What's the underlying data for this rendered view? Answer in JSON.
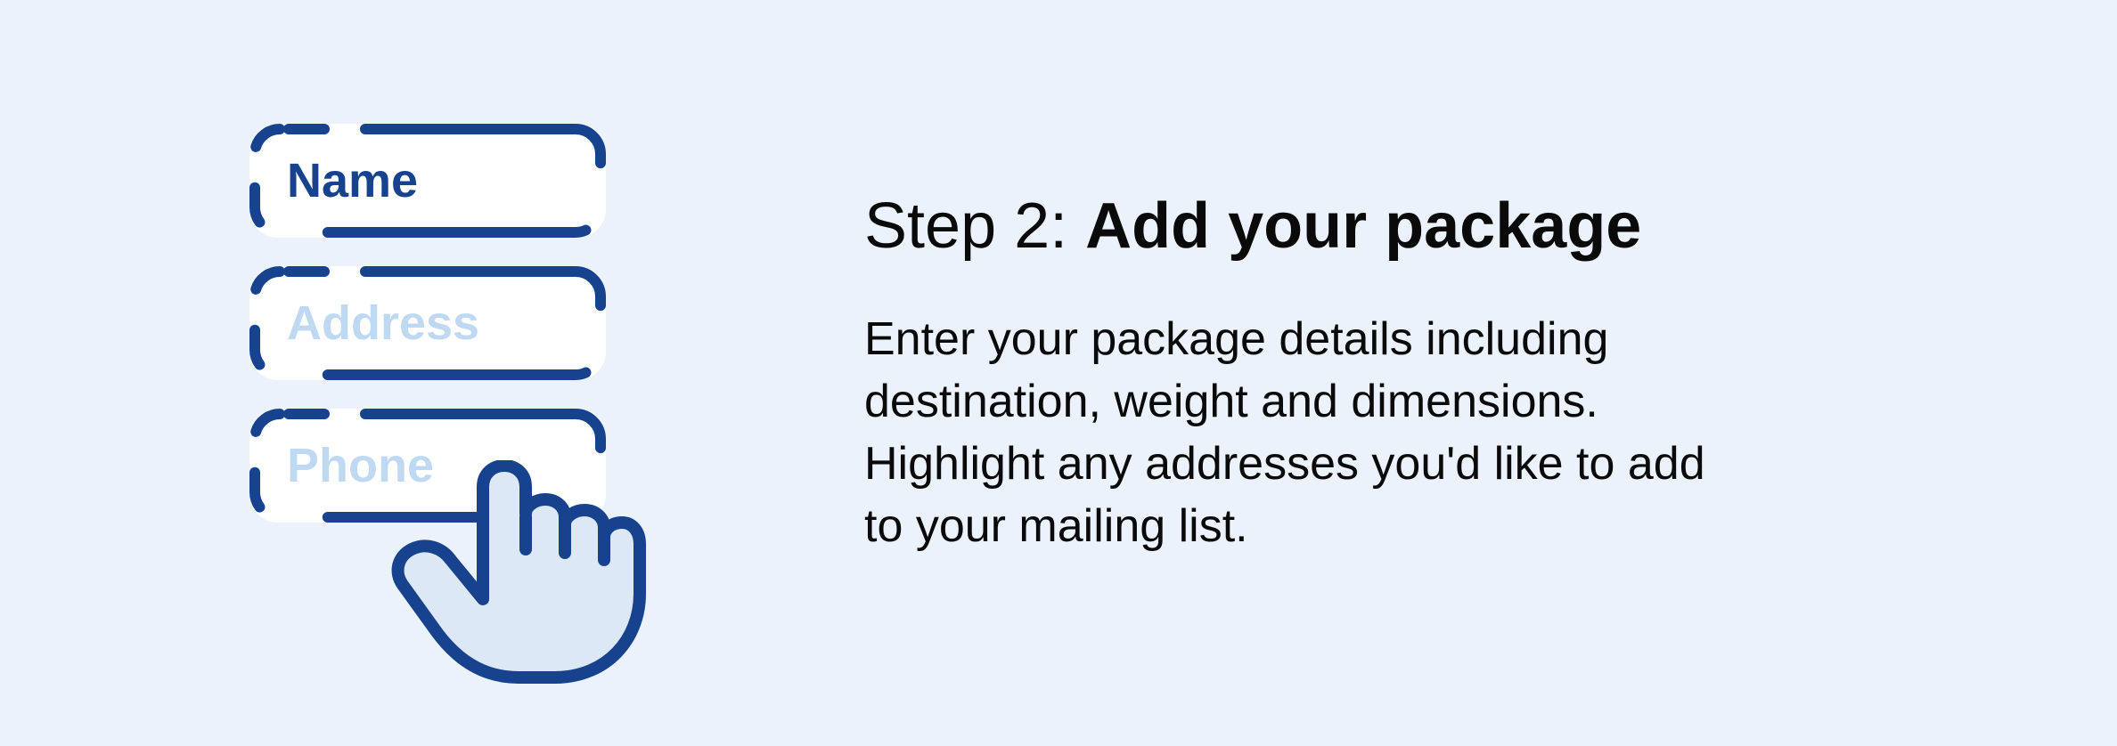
{
  "illustration": {
    "fields": [
      {
        "label": "Name",
        "active": true
      },
      {
        "label": "Address",
        "active": false
      },
      {
        "label": "Phone",
        "active": false
      }
    ]
  },
  "content": {
    "step_prefix": "Step 2: ",
    "step_title": "Add your package",
    "description": "Enter your package details including destination, weight and dimensions. Highlight any addresses you'd like to add to your mailing list."
  },
  "colors": {
    "background": "#ebf2fb",
    "field_border": "#17428e",
    "active_text": "#17428e",
    "inactive_text": "#c0d9f2",
    "body_text": "#0a0a0a"
  }
}
